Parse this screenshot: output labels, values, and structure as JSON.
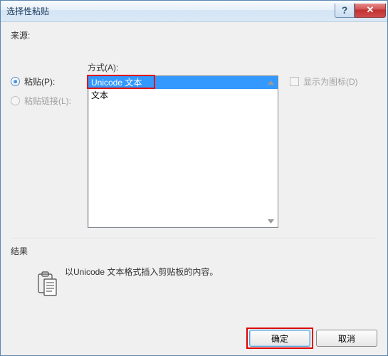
{
  "title": "选择性粘贴",
  "source_label": "来源:",
  "radios": {
    "paste": "粘贴(P):",
    "paste_link": "粘贴链接(L):"
  },
  "method_label": "方式(A):",
  "list": {
    "items": [
      "Unicode 文本",
      "文本"
    ],
    "selected_index": 0
  },
  "display_as_icon": "显示为图标(D)",
  "result_label": "结果",
  "description": "以Unicode 文本格式插入剪贴板的内容。",
  "buttons": {
    "ok": "确定",
    "cancel": "取消"
  }
}
